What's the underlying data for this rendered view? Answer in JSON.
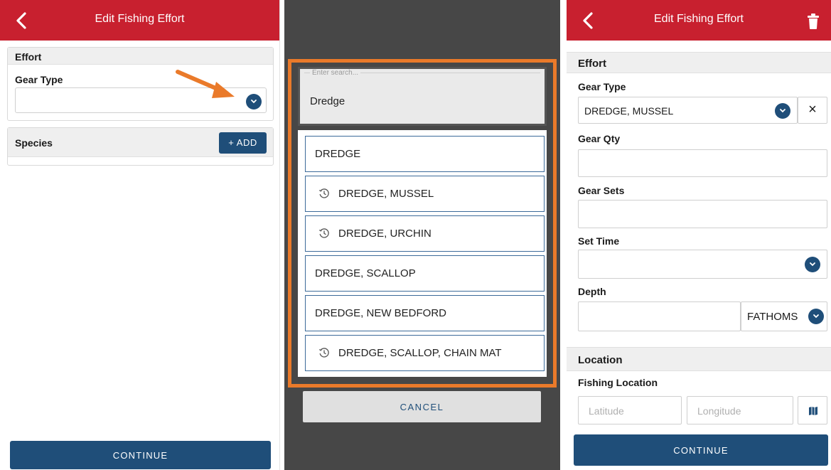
{
  "left": {
    "header_title": "Edit Fishing Effort",
    "effort_section": "Effort",
    "gear_type_label": "Gear Type",
    "gear_type_value": "",
    "species_section": "Species",
    "add_button": "+ ADD",
    "continue_button": "CONTINUE"
  },
  "middle": {
    "search_placeholder": "Enter search...",
    "search_value": "Dredge",
    "options": [
      {
        "label": "DREDGE",
        "recent": false
      },
      {
        "label": "DREDGE, MUSSEL",
        "recent": true
      },
      {
        "label": "DREDGE, URCHIN",
        "recent": true
      },
      {
        "label": "DREDGE, SCALLOP",
        "recent": false
      },
      {
        "label": "DREDGE, NEW BEDFORD",
        "recent": false
      },
      {
        "label": "DREDGE, SCALLOP, CHAIN MAT",
        "recent": true
      }
    ],
    "cancel_button": "CANCEL"
  },
  "right": {
    "header_title": "Edit Fishing Effort",
    "effort_section": "Effort",
    "gear_type_label": "Gear Type",
    "gear_type_value": "DREDGE, MUSSEL",
    "clear_symbol": "×",
    "gear_qty_label": "Gear Qty",
    "gear_qty_value": "",
    "gear_sets_label": "Gear Sets",
    "gear_sets_value": "",
    "set_time_label": "Set Time",
    "set_time_value": "",
    "depth_label": "Depth",
    "depth_value": "",
    "depth_unit": "FATHOMS",
    "location_section": "Location",
    "fishing_location_label": "Fishing Location",
    "latitude_placeholder": "Latitude",
    "longitude_placeholder": "Longitude",
    "continue_button": "CONTINUE"
  },
  "colors": {
    "header_red": "#c8202f",
    "primary_blue": "#1f4e79",
    "highlight_orange": "#ea7a2a",
    "overlay_gray": "#474747"
  },
  "icons": [
    "back-chevron-icon",
    "chevron-down-icon",
    "history-icon",
    "trash-icon",
    "close-icon",
    "map-icon",
    "arrow-annotation"
  ]
}
